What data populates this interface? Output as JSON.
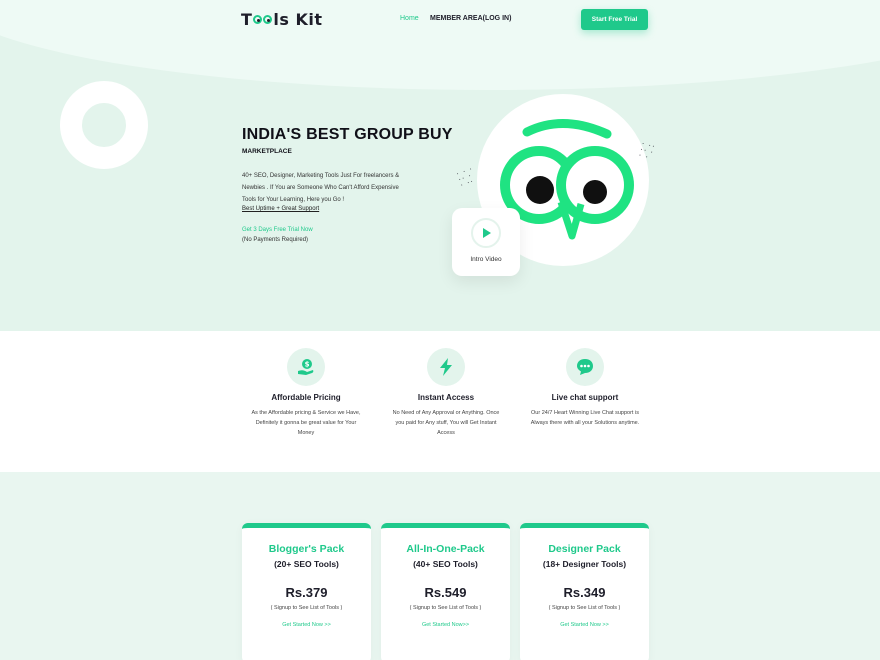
{
  "brand": {
    "logo_left": "T",
    "logo_right": "ls Kit",
    "accent": "#1fc98b",
    "dark": "#1e1e2a"
  },
  "nav": {
    "home": "Home",
    "member": "MEMBER AREA(LOG IN)",
    "cta": "Start Free Trial"
  },
  "hero": {
    "title": "INDIA'S BEST GROUP BUY",
    "subtitle": "MARKETPLACE",
    "description": "40+ SEO, Designer, Marketing Tools Just For freelancers & Newbies . If You are Someone Who Can't Afford Expensive Tools for Your Learning, Here you Go !",
    "highlight": "Best Uptime + Great Support",
    "trial_link": "Get 3 Days Free Trial Now",
    "trial_note": "(No Payments Required)",
    "video_label": "Intro Video"
  },
  "features": [
    {
      "icon": "dollar-hand-icon",
      "title": "Affordable Pricing",
      "desc": "As the Affordable pricing & Service we Have, Definitely it gonna be great value for Your Money"
    },
    {
      "icon": "lightning-icon",
      "title": "Instant Access",
      "desc": "No Need of Any Approval or Anything. Once you paid for Any stuff, You will Get Instant Access"
    },
    {
      "icon": "chat-icon",
      "title": "Live chat support",
      "desc": "Our 24/7 Heart Winning Live Chat support is Always there with all your Solutions anytime."
    }
  ],
  "pricing": [
    {
      "name": "Blogger's Pack",
      "count": "(20+ SEO Tools)",
      "price": "Rs.379",
      "note": "( Signup to See List of Tools )",
      "link": "Get Started Now >>"
    },
    {
      "name": "All-In-One-Pack",
      "count": "(40+ SEO Tools)",
      "price": "Rs.549",
      "note": "( Signup to See List of Tools )",
      "link": "Get Started Now>>"
    },
    {
      "name": "Designer Pack",
      "count": "(18+ Designer Tools)",
      "price": "Rs.349",
      "note": "( Signup to See List of Tools )",
      "link": "Get Started Now >>"
    }
  ]
}
